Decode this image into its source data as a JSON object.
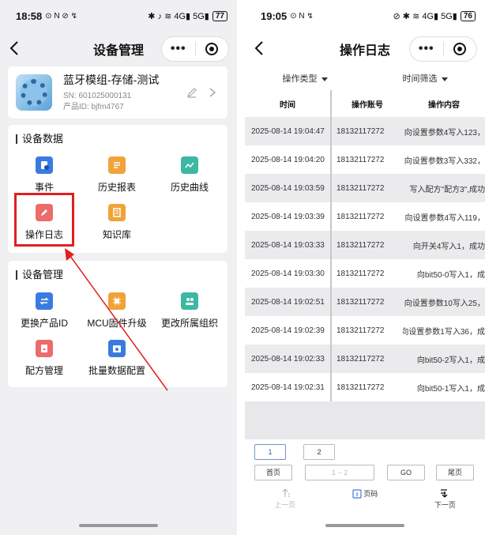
{
  "left_screen": {
    "status": {
      "time": "18:58",
      "indicators": "⊙ N ⊘ ↯",
      "right_icons": "✱ ♪ ≋ 4G▮ 5G▮",
      "battery": "77"
    },
    "nav": {
      "title": "设备管理",
      "more": "•••"
    },
    "device": {
      "name": "蓝牙模组-存储-测试",
      "sn": "SN: 601025000131",
      "product_id": "产品ID: bjfm4767"
    },
    "data_section": {
      "title": "设备数据",
      "items": [
        {
          "label": "事件",
          "icon": "event-icon",
          "color": "#3b7be0"
        },
        {
          "label": "历史报表",
          "icon": "report-icon",
          "color": "#f0a33a"
        },
        {
          "label": "历史曲线",
          "icon": "curve-icon",
          "color": "#3db8a2"
        },
        {
          "label": "操作日志",
          "icon": "log-icon",
          "color": "#ec6b6b"
        },
        {
          "label": "知识库",
          "icon": "knowledge-icon",
          "color": "#f0a33a"
        }
      ]
    },
    "mgmt_section": {
      "title": "设备管理",
      "items": [
        {
          "label": "更换产品ID",
          "icon": "swap-icon",
          "color": "#3b7be0"
        },
        {
          "label": "MCU固件升级",
          "icon": "chip-icon",
          "color": "#f0a33a"
        },
        {
          "label": "更改所属组织",
          "icon": "group-icon",
          "color": "#3db8a2"
        },
        {
          "label": "配方管理",
          "icon": "recipe-icon",
          "color": "#ec6b6b"
        },
        {
          "label": "批量数据配置",
          "icon": "batch-config-icon",
          "color": "#3b7be0"
        }
      ]
    },
    "highlight_color": "#e02020"
  },
  "right_screen": {
    "status": {
      "time": "19:05",
      "indicators": "⊙ N ↯",
      "right_icons": "⊘ ✱ ≋ 4G▮ 5G▮",
      "battery": "76"
    },
    "nav": {
      "title": "操作日志",
      "more": "•••"
    },
    "filters": {
      "type": "操作类型",
      "time": "时间筛选"
    },
    "table": {
      "headers": {
        "time": "时间",
        "account": "操作账号",
        "content": "操作内容"
      },
      "rows": [
        {
          "time": "2025-08-14 19:04:47",
          "account": "18132117272",
          "content": "向设置参数4写入123，"
        },
        {
          "time": "2025-08-14 19:04:20",
          "account": "18132117272",
          "content": "向设置参数3写入332，"
        },
        {
          "time": "2025-08-14 19:03:59",
          "account": "18132117272",
          "content": "写入配方\"配方3\",成功"
        },
        {
          "time": "2025-08-14 19:03:39",
          "account": "18132117272",
          "content": "向设置参数4写入119，"
        },
        {
          "time": "2025-08-14 19:03:33",
          "account": "18132117272",
          "content": "向开关4写入1，成功"
        },
        {
          "time": "2025-08-14 19:03:30",
          "account": "18132117272",
          "content": "向bit50-0写入1，成"
        },
        {
          "time": "2025-08-14 19:02:51",
          "account": "18132117272",
          "content": "向设置参数10写入25，"
        },
        {
          "time": "2025-08-14 19:02:39",
          "account": "18132117272",
          "content": "向设置参数1写入36，成"
        },
        {
          "time": "2025-08-14 19:02:33",
          "account": "18132117272",
          "content": "向bit50-2写入1，成"
        },
        {
          "time": "2025-08-14 19:02:31",
          "account": "18132117272",
          "content": "向bit50-1写入1，成"
        }
      ]
    },
    "pager": {
      "pages": [
        "1",
        "2"
      ],
      "first": "首页",
      "range_placeholder": "1 ~ 2",
      "go": "GO",
      "last": "尾页",
      "prev": "上一页",
      "page_code": "页码",
      "next": "下一页"
    }
  }
}
